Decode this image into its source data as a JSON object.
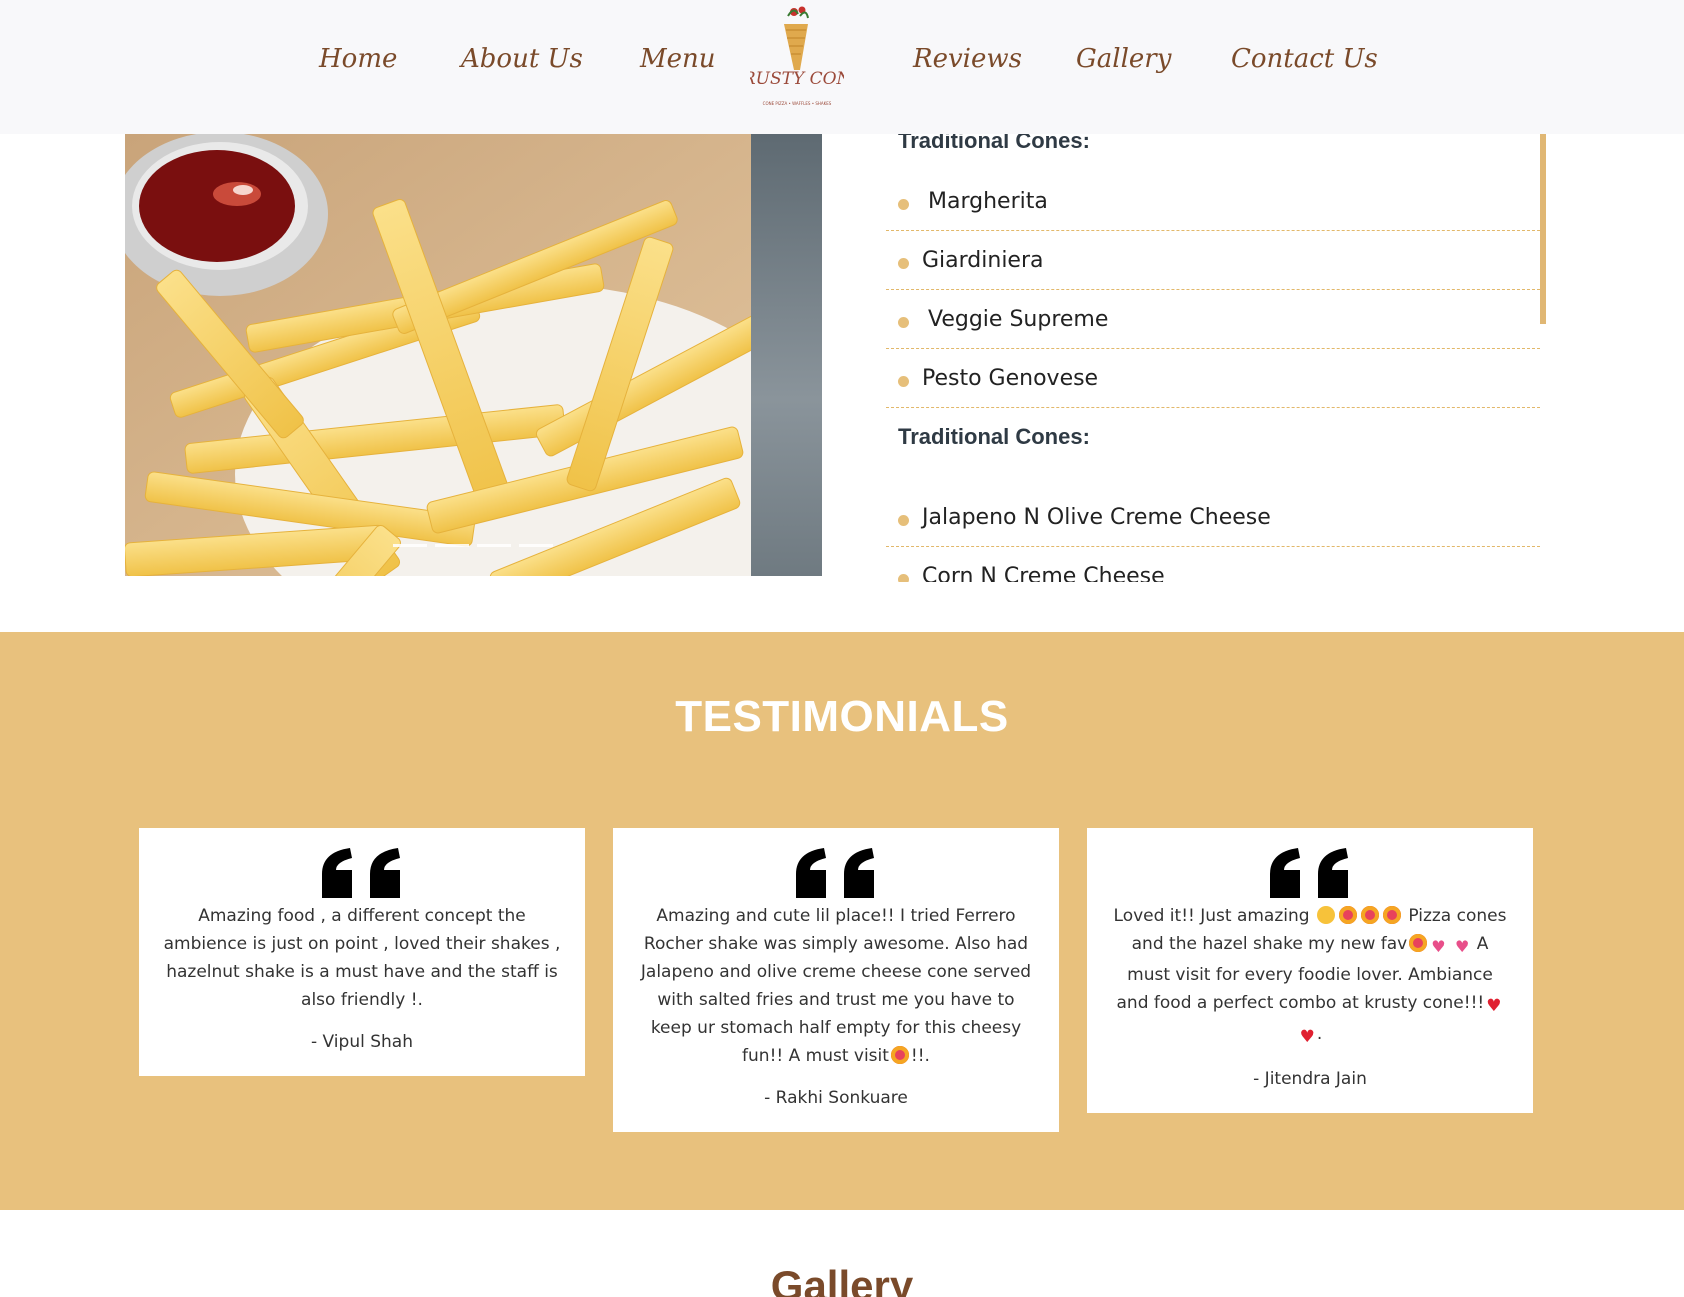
{
  "nav": {
    "items": [
      "Home",
      "About Us",
      "Menu",
      "Reviews",
      "Gallery",
      "Contact Us"
    ],
    "logo_text": "KRUSTY CONE",
    "logo_tagline": "CONE PIZZA • WAFFLES • SHAKES"
  },
  "slider": {
    "image": "french-fries-with-ketchup",
    "dot_count": 4
  },
  "menu": {
    "groups": [
      {
        "heading": "Traditional Cones:",
        "items": [
          "Margherita",
          "Giardiniera",
          "Veggie Supreme",
          "Pesto Genovese"
        ]
      },
      {
        "heading": "Traditional Cones:",
        "items": [
          "Jalapeno N Olive Creme Cheese",
          "Corn N Creme Cheese"
        ]
      }
    ]
  },
  "testimonials": {
    "title": "TESTIMONIALS",
    "cards": [
      {
        "text": "Amazing food , a different concept the ambience is just on point , loved their shakes , hazelnut shake is a must have and the staff is also friendly !.",
        "author": "- Vipul Shah"
      },
      {
        "text_a": "Amazing and cute lil place!! I tried Ferrero Rocher shake was simply awesome. Also had Jalapeno and olive creme cheese cone served with salted fries and trust me you have to keep ur stomach half empty for this cheesy fun!! A must visit",
        "text_b": "!!.",
        "author": "- Rakhi Sonkuare"
      },
      {
        "text_a": "Loved it!! Just amazing",
        "text_b": "Pizza cones and the hazel shake my new fav",
        "text_c": "A must visit for every foodie lover. Ambiance and food a perfect combo at krusty cone!!!",
        "text_d": ".",
        "author": "- Jitendra Jain"
      }
    ]
  },
  "gallery": {
    "title": "Gallery"
  },
  "colors": {
    "accent": "#e8c17d",
    "brand_brown": "#7a4a2a",
    "nav_bg": "#f8f8fa"
  }
}
